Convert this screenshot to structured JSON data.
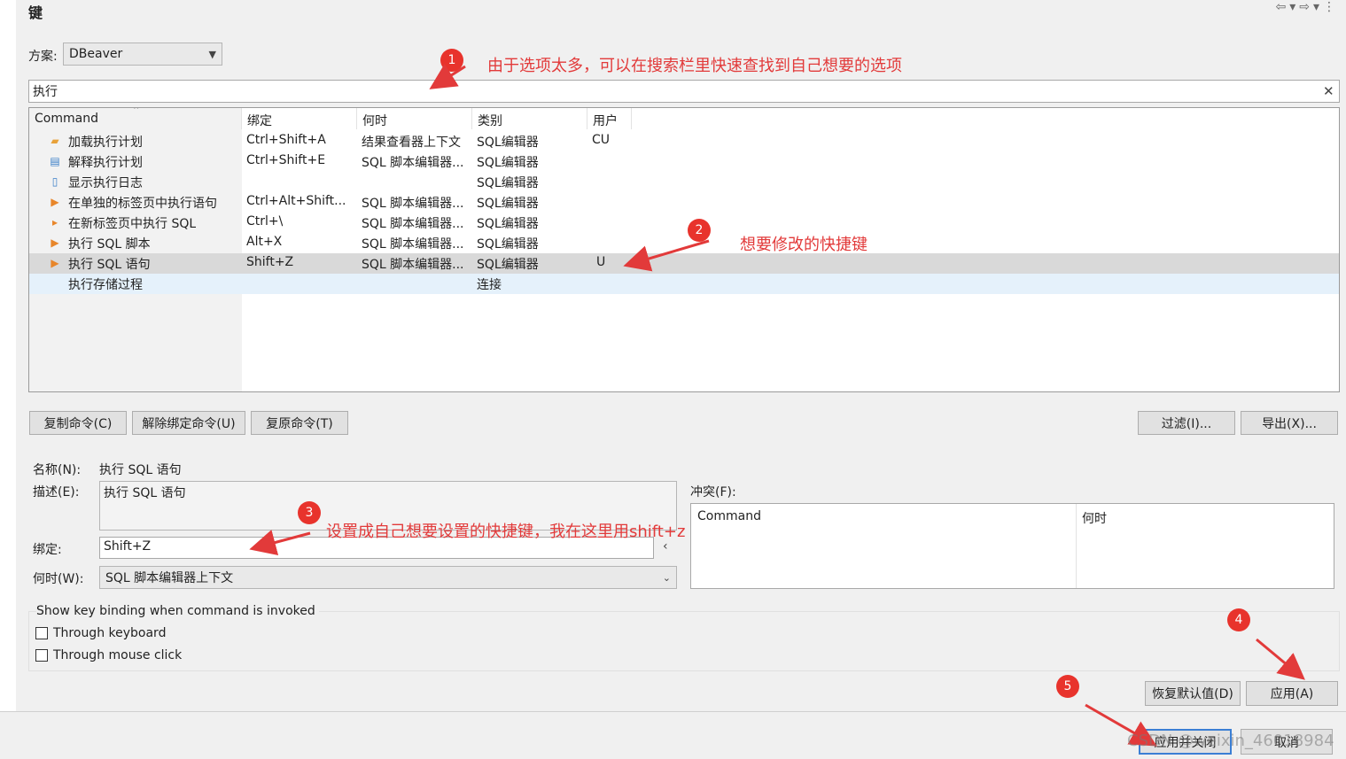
{
  "title": "键",
  "scheme": {
    "label": "方案:",
    "value": "DBeaver"
  },
  "filter": {
    "value": "执行"
  },
  "table": {
    "headers": [
      "Command",
      "绑定",
      "何时",
      "类别",
      "用户"
    ],
    "rows": [
      {
        "icon": "folder-icon",
        "command": "加载执行计划",
        "binding": "Ctrl+Shift+A",
        "when": "结果查看器上下文",
        "category": "SQL编辑器",
        "user": "CU"
      },
      {
        "icon": "document-icon",
        "command": "解释执行计划",
        "binding": "Ctrl+Shift+E",
        "when": "SQL 脚本编辑器...",
        "category": "SQL编辑器",
        "user": ""
      },
      {
        "icon": "log-file-icon",
        "command": "显示执行日志",
        "binding": "",
        "when": "",
        "category": "SQL编辑器",
        "user": ""
      },
      {
        "icon": "run-in-tab-icon",
        "command": "在单独的标签页中执行语句",
        "binding": "Ctrl+Alt+Shift...",
        "when": "SQL 脚本编辑器...",
        "category": "SQL编辑器",
        "user": ""
      },
      {
        "icon": "run-new-tab-icon",
        "command": "在新标签页中执行 SQL",
        "binding": "Ctrl+\\",
        "when": "SQL 脚本编辑器...",
        "category": "SQL编辑器",
        "user": ""
      },
      {
        "icon": "run-script-icon",
        "command": "执行 SQL 脚本",
        "binding": "Alt+X",
        "when": "SQL 脚本编辑器...",
        "category": "SQL编辑器",
        "user": ""
      },
      {
        "icon": "run-icon",
        "command": "执行 SQL 语句",
        "binding": "Shift+Z",
        "when": "SQL 脚本编辑器...",
        "category": "SQL编辑器",
        "user": "U"
      },
      {
        "icon": "",
        "command": "执行存储过程",
        "binding": "",
        "when": "",
        "category": "连接",
        "user": ""
      }
    ]
  },
  "buttons": {
    "copy": "复制命令(C)",
    "unbind": "解除绑定命令(U)",
    "restore": "复原命令(T)",
    "filter": "过滤(I)...",
    "export": "导出(X)...",
    "restore_defaults": "恢复默认值(D)",
    "apply": "应用(A)",
    "apply_close": "应用并关闭",
    "cancel": "取消"
  },
  "details": {
    "name_label": "名称(N):",
    "name_value": "执行 SQL 语句",
    "desc_label": "描述(E):",
    "desc_value": "执行 SQL 语句",
    "binding_label": "绑定:",
    "binding_value": "Shift+Z",
    "when_label": "何时(W):",
    "when_value": "SQL 脚本编辑器上下文",
    "conflict_label": "冲突(F):",
    "conflict_headers": [
      "Command",
      "何时"
    ]
  },
  "show_binding": {
    "title": "Show key binding when command is invoked",
    "keyboard": "Through keyboard",
    "mouse": "Through mouse click"
  },
  "annotations": {
    "a1": {
      "num": "1",
      "text": "由于选项太多，可以在搜索栏里快速查找到自己想要的选项"
    },
    "a2": {
      "num": "2",
      "text": "想要修改的快捷键"
    },
    "a3": {
      "num": "3",
      "text": "设置成自己想要设置的快捷键，我在这里用shift+z"
    },
    "a4": {
      "num": "4"
    },
    "a5": {
      "num": "5"
    }
  },
  "watermark": "CSDN @weixin_46018984",
  "colors": {
    "annotation_red": "#e23a3a",
    "selected_row": "#d9d9d9",
    "hover_row": "#e5f1fb"
  }
}
